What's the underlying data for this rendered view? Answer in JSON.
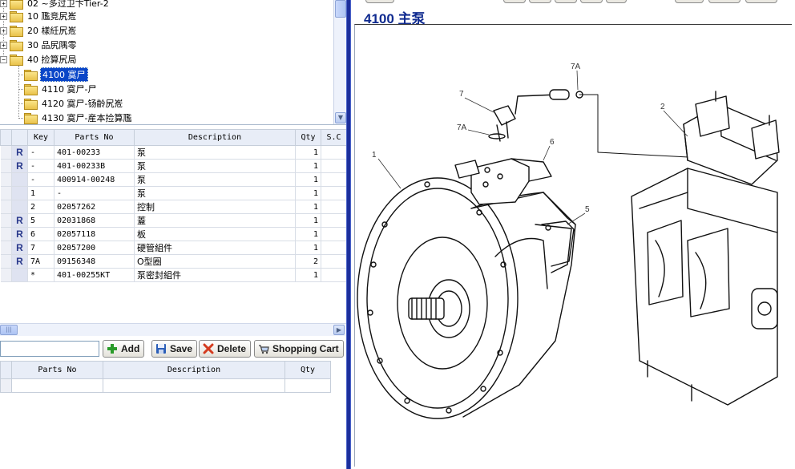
{
  "tree": {
    "items": [
      {
        "label": "02 ~多过卫卞Tier-2",
        "expanded": false
      },
      {
        "label": "10 尶竞尻峞",
        "expanded": false
      },
      {
        "label": "20 樣紝尻峞",
        "expanded": false
      },
      {
        "label": "30 品尻隅零",
        "expanded": false
      },
      {
        "label": "40 捡算尻局",
        "expanded": true
      },
      {
        "label": "4100 寞尸",
        "selected": true
      },
      {
        "label": "4110 寞尸-尸"
      },
      {
        "label": "4120 寞尸-钖齡尻峞"
      },
      {
        "label": "4130 寞尸-産本捡算尶"
      }
    ]
  },
  "parts_table": {
    "columns": [
      "Key",
      "Parts No",
      "Description",
      "Qty",
      "S.C"
    ],
    "rows": [
      {
        "r": "R",
        "key": "-",
        "parts_no": "401-00233",
        "description": "泵",
        "qty": "1"
      },
      {
        "r": "R",
        "key": "-",
        "parts_no": "401-00233B",
        "description": "泵",
        "qty": "1"
      },
      {
        "r": "",
        "key": "-",
        "parts_no": "400914-00248",
        "description": "泵",
        "qty": "1"
      },
      {
        "r": "",
        "key": "1",
        "parts_no": "-",
        "description": "泵",
        "qty": "1"
      },
      {
        "r": "",
        "key": "2",
        "parts_no": "02057262",
        "description": "控制",
        "qty": "1"
      },
      {
        "r": "R",
        "key": "5",
        "parts_no": "02031868",
        "description": "蓋",
        "qty": "1"
      },
      {
        "r": "R",
        "key": "6",
        "parts_no": "02057118",
        "description": "板",
        "qty": "1"
      },
      {
        "r": "R",
        "key": "7",
        "parts_no": "02057200",
        "description": "硬管組件",
        "qty": "1"
      },
      {
        "r": "R",
        "key": "7A",
        "parts_no": "09156348",
        "description": "O型圈",
        "qty": "2"
      },
      {
        "r": "",
        "key": "*",
        "parts_no": "401-00255KT",
        "description": "泵密封組件",
        "qty": "1"
      }
    ]
  },
  "toolbar": {
    "input_value": "",
    "add_label": "Add",
    "save_label": "Save",
    "delete_label": "Delete",
    "cart_label": "Shopping Cart"
  },
  "cart_table": {
    "columns": [
      "Parts No",
      "Description",
      "Qty"
    ]
  },
  "diagram": {
    "title": "4100 主泵",
    "callouts": {
      "c1": "1",
      "c2": "2",
      "c5": "5",
      "c6": "6",
      "c7": "7",
      "c7a_top": "7A",
      "c7a_mid": "7A"
    }
  }
}
